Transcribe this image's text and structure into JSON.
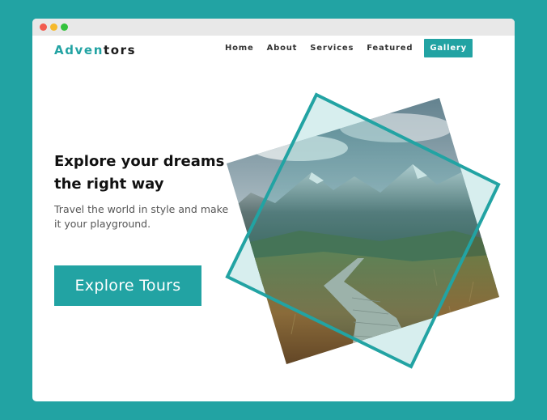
{
  "brand": {
    "logo_part1": "Adven",
    "logo_part2": "tors",
    "accent_color": "#22a3a3"
  },
  "nav": {
    "items": [
      {
        "label": "Home"
      },
      {
        "label": "About"
      },
      {
        "label": "Services"
      },
      {
        "label": "Featured"
      }
    ],
    "cta_label": "Gallery"
  },
  "hero": {
    "title_line1": "Explore your dreams",
    "title_line2": "the right way",
    "subtitle": "Travel the world in style and make it your playground.",
    "button_label": "Explore Tours"
  },
  "image": {
    "subject": "mountain-boardwalk-landscape"
  }
}
